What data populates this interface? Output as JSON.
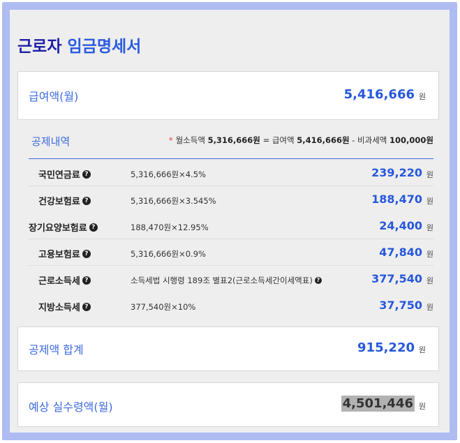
{
  "title": {
    "part1": "근로자",
    "part2": "임금명세서"
  },
  "gross": {
    "label": "급여액(월)",
    "amount": "5,416,666",
    "unit": "원"
  },
  "deductions": {
    "section_title": "공제내역",
    "note_star": "*",
    "note_pre": "월소득액",
    "note_income": "5,316,666원",
    "note_eq": "= 급여액",
    "note_gross": "5,416,666원",
    "note_minus": "- 비과세액",
    "note_nontax": "100,000원",
    "items": [
      {
        "name": "국민연금료",
        "formula": "5,316,666원×4.5%",
        "value": "239,220",
        "unit": "원"
      },
      {
        "name": "건강보험료",
        "formula": "5,316,666원×3.545%",
        "value": "188,470",
        "unit": "원"
      },
      {
        "name": "장기요양보험료",
        "formula": "188,470원×12.95%",
        "value": "24,400",
        "unit": "원"
      },
      {
        "name": "고용보험료",
        "formula": "5,316,666원×0.9%",
        "value": "47,840",
        "unit": "원"
      },
      {
        "name": "근로소득세",
        "formula": "소득세법 시행령 189조 별표2(근로소득세간이세액표)",
        "value": "377,540",
        "unit": "원"
      },
      {
        "name": "지방소득세",
        "formula": "377,540원×10%",
        "value": "37,750",
        "unit": "원"
      }
    ]
  },
  "total": {
    "label": "공제액 합계",
    "amount": "915,220",
    "unit": "원"
  },
  "net": {
    "label": "예상 실수령액(월)",
    "amount": "4,501,446",
    "unit": "원"
  },
  "icons": {
    "help": "question-circle-icon"
  },
  "colors": {
    "accent": "#2758dc",
    "title_dark": "#1e1ea8",
    "frame": "#aebcf2",
    "note_star": "#e03a3a"
  }
}
